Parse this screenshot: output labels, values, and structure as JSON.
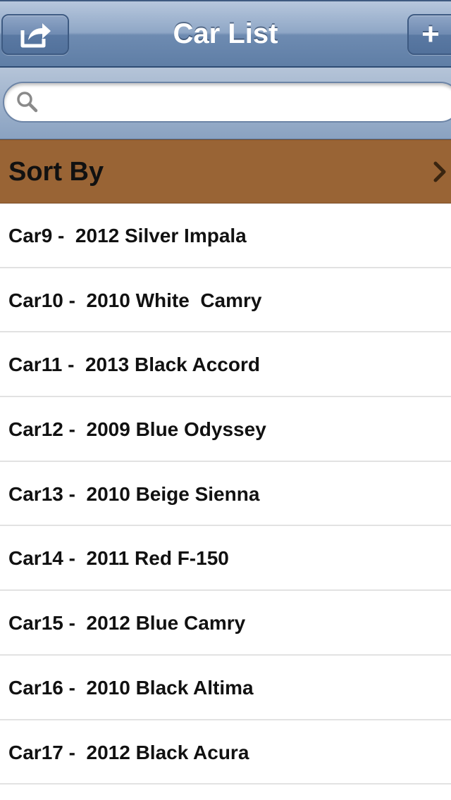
{
  "navbar": {
    "title": "Car List",
    "share_icon": "share-icon",
    "add_label": "+",
    "color": "#6e8bb1"
  },
  "search": {
    "placeholder": "",
    "value": "",
    "icon": "search-icon"
  },
  "sort_by": {
    "label": "Sort By",
    "icon": "chevron-right-icon",
    "color": "#996435"
  },
  "cars": [
    {
      "label": "Car9 -  2012 Silver Impala"
    },
    {
      "label": "Car10 -  2010 White  Camry"
    },
    {
      "label": "Car11 -  2013 Black Accord"
    },
    {
      "label": "Car12 -  2009 Blue Odyssey"
    },
    {
      "label": "Car13 -  2010 Beige Sienna"
    },
    {
      "label": "Car14 -  2011 Red F-150"
    },
    {
      "label": "Car15 -  2012 Blue Camry"
    },
    {
      "label": "Car16 -  2010 Black Altima"
    },
    {
      "label": "Car17 -  2012 Black Acura"
    }
  ]
}
